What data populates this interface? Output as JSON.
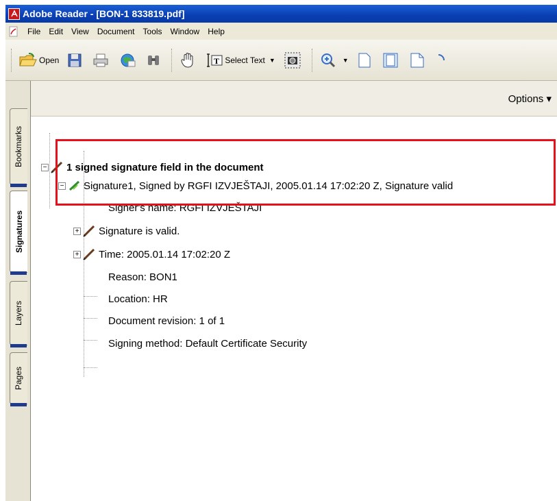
{
  "window": {
    "title": "Adobe Reader - [BON-1 833819.pdf]"
  },
  "menu": {
    "items": [
      "File",
      "Edit",
      "View",
      "Document",
      "Tools",
      "Window",
      "Help"
    ]
  },
  "toolbar": {
    "open_label": "Open",
    "select_text_label": "Select Text"
  },
  "sidebar": {
    "tabs": [
      "Bookmarks",
      "Signatures",
      "Layers",
      "Pages"
    ],
    "active": "Signatures"
  },
  "panel": {
    "options_label": "Options ▾",
    "root": "1 signed signature field in the document",
    "signature": "Signature1, Signed by RGFI IZVJEŠTAJI, 2005.01.14 17:02:20 Z, Signature valid",
    "signer_name": "Signer's name: RGFI IZVJEŠTAJI",
    "validity": "Signature is valid.",
    "time": "Time: 2005.01.14 17:02:20 Z",
    "reason": "Reason: BON1",
    "location": "Location: HR",
    "revision": "Document revision: 1 of 1",
    "method": "Signing method: Default Certificate Security"
  },
  "colors": {
    "highlight": "#e5101a",
    "titlebar": "#0a3fb3"
  }
}
